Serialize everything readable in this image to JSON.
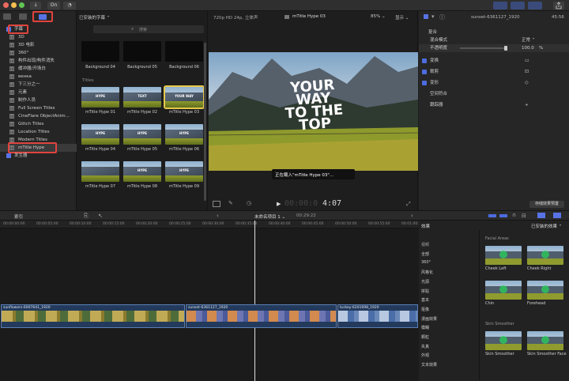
{
  "toolbar": {
    "key_label": "On"
  },
  "library": {
    "items": [
      {
        "label": "字幕",
        "icon": "folder-icon",
        "highlighted": true
      },
      {
        "label": "3D",
        "icon": "T-icon"
      },
      {
        "label": "3D 电影",
        "icon": "T-icon"
      },
      {
        "label": "360°",
        "icon": "T-icon"
      },
      {
        "label": "构件出现/构件消失",
        "icon": "T-icon"
      },
      {
        "label": "缓冲器/开场白",
        "icon": "T-icon"
      },
      {
        "label": "венка",
        "icon": "T-icon"
      },
      {
        "label": "下三分之一",
        "icon": "T-icon"
      },
      {
        "label": "元素",
        "icon": "T-icon"
      },
      {
        "label": "制作人员",
        "icon": "T-icon"
      },
      {
        "label": "Full Screen Titles",
        "icon": "T-icon"
      },
      {
        "label": "CineFlare ObjectAnim...",
        "icon": "T-icon"
      },
      {
        "label": "Glitch Titles",
        "icon": "T-icon"
      },
      {
        "label": "Location Titles",
        "icon": "T-icon"
      },
      {
        "label": "Modern Titles",
        "icon": "T-icon"
      },
      {
        "label": "mTitle Hype",
        "icon": "T-icon",
        "highlighted": true
      },
      {
        "label": "发生器",
        "icon": "folder-icon"
      }
    ]
  },
  "browser": {
    "dropdown": "已安装的字幕 ⌃",
    "search_placeholder": "搜索",
    "top_items": [
      "Background 04",
      "Background 05",
      "Background 06"
    ],
    "section": "Titles",
    "titles": [
      {
        "label": "mTitle Hype 01",
        "text": "HYPE"
      },
      {
        "label": "mTitle Hype 02",
        "text": "TEXT"
      },
      {
        "label": "mTitle Hype 03",
        "text": "YOUR WAY",
        "selected": true
      },
      {
        "label": "mTitle Hype 04",
        "text": "HYPE"
      },
      {
        "label": "mTitle Hype 05",
        "text": "HYPE"
      },
      {
        "label": "mTitle Hype 06",
        "text": "HYPE"
      },
      {
        "label": "mTitle Hype 07",
        "text": ""
      },
      {
        "label": "mTitle Hype 08",
        "text": "HYPE"
      },
      {
        "label": "mTitle Hype 09",
        "text": "HYPE"
      }
    ]
  },
  "viewer": {
    "format": "720p HD 24p, 立体声",
    "title": "mTitle Hype 03",
    "zoom": "85% ⌄",
    "show": "显示 ⌄",
    "overlay": [
      "YOUR",
      "WAY",
      "TO THE",
      "TOP"
    ],
    "loading": "正在载入\"mTitle Hype 03\"...",
    "timecode_dim": "00:00:0",
    "timecode": "4:07"
  },
  "inspector": {
    "clip_name": "sunset-6361127_1920",
    "duration": "45:56",
    "composite": "复合",
    "blend_label": "混合模式",
    "blend_value": "正常 ⌃",
    "opacity_label": "不透明度",
    "opacity_value": "100.0",
    "opacity_unit": "%",
    "transform": "变换",
    "crop": "裁剪",
    "distort": "变形",
    "spatial": "空间符合",
    "stabilize": "跟踪器",
    "save_button": "存储效果预置"
  },
  "timeline_bar": {
    "index": "索引",
    "project": "未命名项目 1 ⌄",
    "duration": "00:29:22",
    "effects_header": "效果",
    "installed": "已安装的效果 ⌃"
  },
  "ruler": [
    "00:00:00:00",
    "00:00:05:00",
    "00:00:10:00",
    "00:00:15:00",
    "00:00:20:00",
    "00:00:25:00",
    "00:00:30:00",
    "00:00:35:00",
    "00:00:40:00",
    "00:00:45:00",
    "00:00:50:00",
    "00:00:55:00",
    "00:01:00:00"
  ],
  "clips": [
    {
      "label": "sunflowers-6007641_1920"
    },
    {
      "label": "sunset-6361127_1920"
    },
    {
      "label": "turkey-6201698_1920"
    }
  ],
  "effects": {
    "categories": [
      "视频",
      "全部",
      "360°",
      "风格化",
      "光源",
      "拼贴",
      "基本",
      "抠像",
      "漫画效果",
      "模糊",
      "颗粒",
      "失真",
      "外观",
      "文本效果"
    ],
    "sections": [
      {
        "title": "Facial Areas",
        "items": [
          "Cheek Left",
          "Cheek Right",
          "Chin",
          "Forehead"
        ]
      },
      {
        "title": "Skin Smoother",
        "items": [
          "Skin Smoother",
          "Skin Smoother Face"
        ]
      }
    ]
  },
  "colors": {
    "accent": "#4d6ce0",
    "highlight_box": "#e0443e",
    "clip_blue": "#233a5c",
    "selected_yellow": "#e6c84a"
  }
}
